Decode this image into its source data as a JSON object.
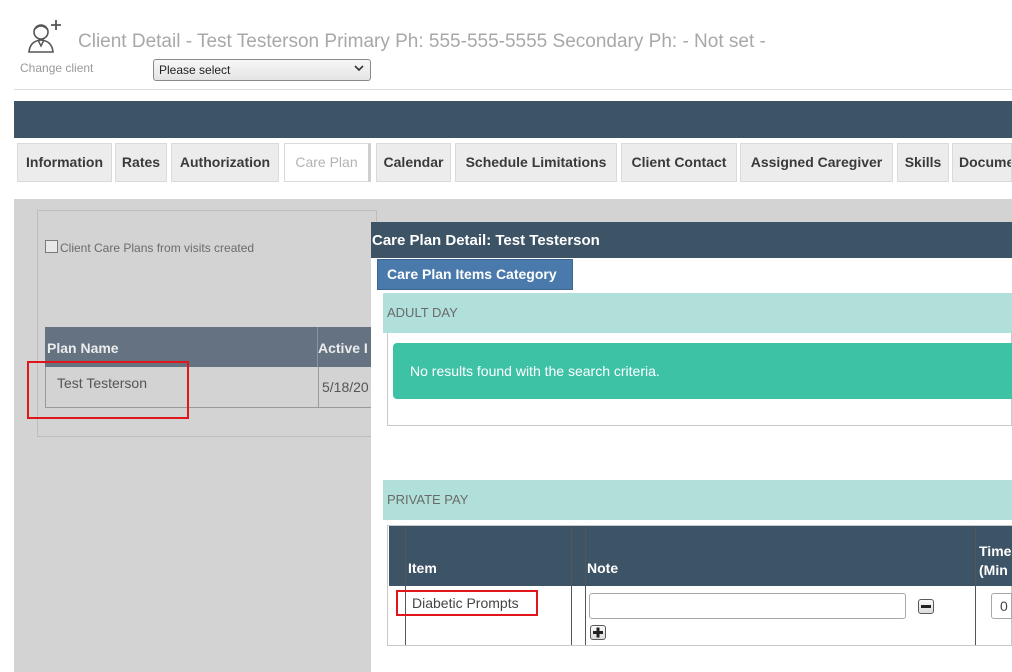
{
  "header": {
    "title": "Client Detail - Test Testerson Primary Ph: 555-555-5555 Secondary Ph: - Not set -",
    "change_client_label": "Change client",
    "client_select_value": "Please select",
    "icon": "client-add-icon"
  },
  "tabs": [
    {
      "label": "Information"
    },
    {
      "label": "Rates"
    },
    {
      "label": "Authorization"
    },
    {
      "label": "Care Plan",
      "active": true
    },
    {
      "label": "Calendar"
    },
    {
      "label": "Schedule Limitations"
    },
    {
      "label": "Client Contact"
    },
    {
      "label": "Assigned Caregiver"
    },
    {
      "label": "Skills"
    },
    {
      "label": "Docume"
    }
  ],
  "left_panel": {
    "checkbox_label": "Client Care Plans from visits created",
    "columns": [
      "Plan Name",
      "Active I"
    ],
    "rows": [
      {
        "plan_name": "Test Testerson",
        "active": "5/18/20"
      }
    ]
  },
  "modal": {
    "title": "Care Plan Detail: Test Testerson",
    "category_tab": "Care Plan Items Category",
    "sections": [
      {
        "name": "ADULT DAY",
        "message": "No results found with the search criteria."
      },
      {
        "name": "PRIVATE PAY"
      }
    ],
    "table": {
      "columns": {
        "item": "Item",
        "note": "Note",
        "time_line1": "Time",
        "time_line2": "(Min"
      },
      "rows": [
        {
          "item": "Diabetic Prompts",
          "note": "",
          "time": "0"
        }
      ]
    }
  },
  "colors": {
    "nav": "#3d5366",
    "section": "#b1e0da",
    "alert": "#3ec2a6",
    "category_tab": "#4a7aab",
    "highlight": "#e0161b"
  }
}
